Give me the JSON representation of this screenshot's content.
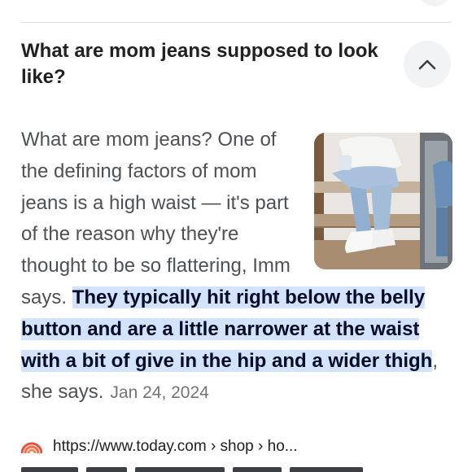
{
  "question": {
    "text": "What are mom jeans supposed to look like?"
  },
  "answer": {
    "intro": "What are mom jeans? One of the defining factors of mom jeans is a high waist — it's part of the reason why they're thought to be so flattering, Imm says. ",
    "highlight": "They typically hit right below the belly button and are a little narrower at the waist with a bit of give in the hip and a wider thigh",
    "outro": ", she says.",
    "date": "Jan 24, 2024"
  },
  "source": {
    "url": "https://www.today.com › shop › ho..."
  },
  "colors": {
    "highlight_bg": "#d3e3fd",
    "source_icon": "#e8553f",
    "button_bg": "#f1f3f4"
  },
  "icons": {
    "collapse": "chevron-up-icon",
    "source": "today-rainbow-logo-icon"
  }
}
